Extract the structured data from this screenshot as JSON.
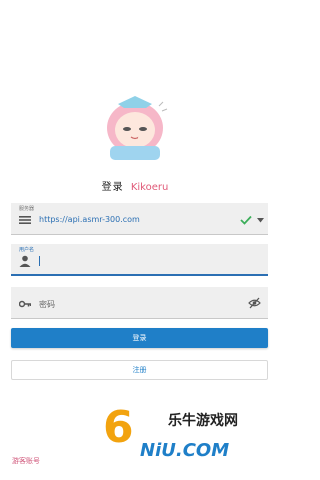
{
  "header": {
    "title_zh": "登录",
    "brand": "Kikoeru",
    "mascot_icon": "anime-mascot-avatar"
  },
  "server_field": {
    "label": "服务器",
    "value": "https://api.asmr-300.com",
    "lead_icon": "list-icon",
    "status_icon": "check-icon",
    "menu_icon": "dropdown-arrow-icon"
  },
  "username_field": {
    "label": "用户名",
    "value": "",
    "lead_icon": "person-icon"
  },
  "password_field": {
    "placeholder": "密码",
    "lead_icon": "key-icon",
    "trail_icon": "eye-off-icon"
  },
  "buttons": {
    "login": "登录",
    "register": "注册"
  },
  "guest_link": "游客账号",
  "watermark": {
    "number": "6",
    "zh": "乐牛游戏网",
    "en": "NiU.COM"
  },
  "colors": {
    "accent": "#1f7fc8",
    "brand": "#e05a78",
    "success": "#3cae5a"
  }
}
